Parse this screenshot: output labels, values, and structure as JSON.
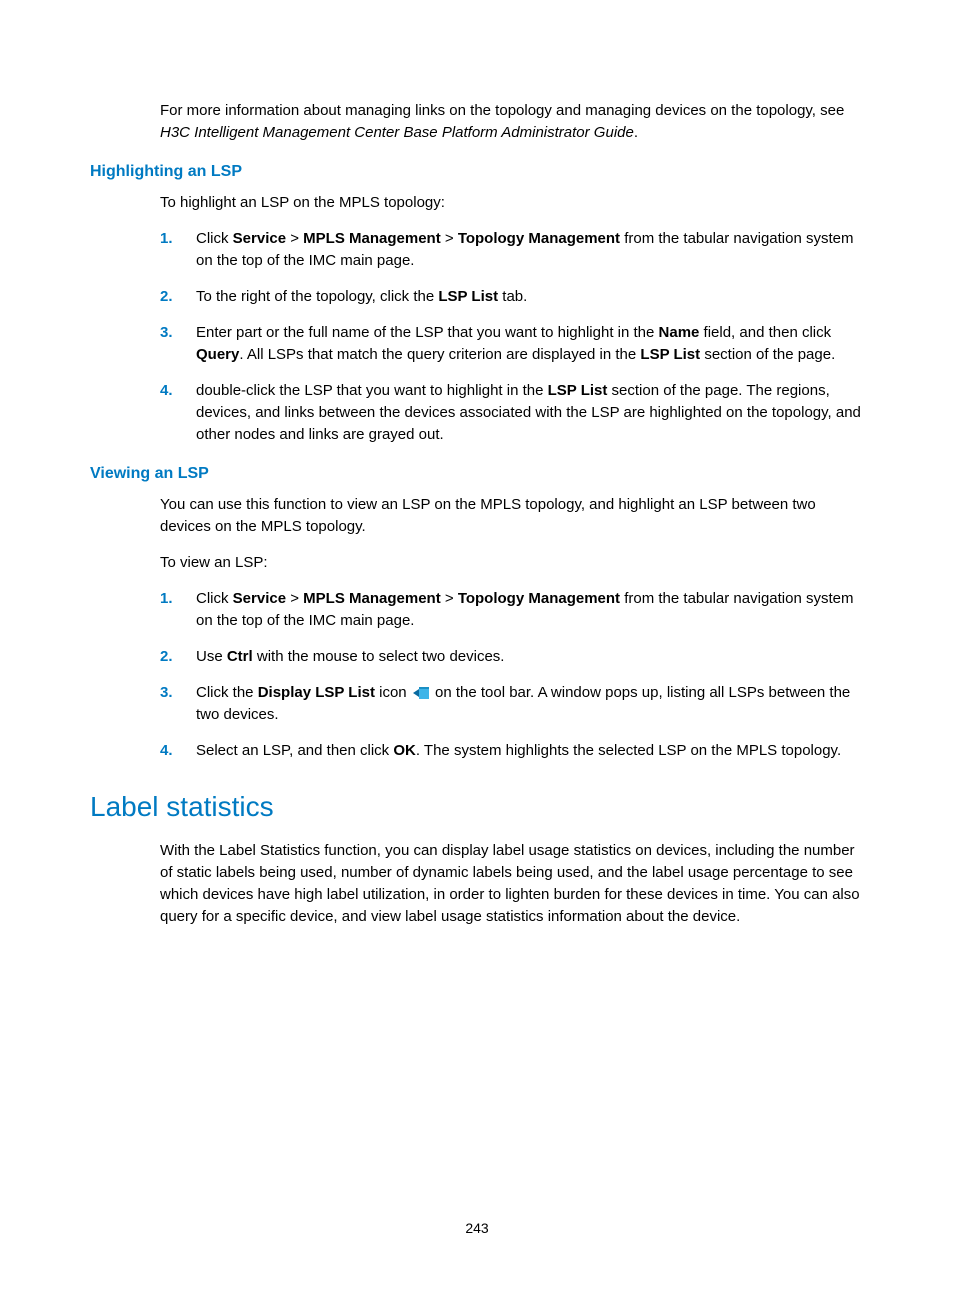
{
  "intro": {
    "p1a": "For more information about managing links on the topology and managing devices on the topology, see ",
    "p1b": "H3C Intelligent Management Center Base Platform Administrator Guide",
    "p1c": "."
  },
  "highlight": {
    "heading": "Highlighting an LSP",
    "p1": "To highlight an LSP on the MPLS topology:",
    "li1": {
      "num": "1.",
      "a": "Click ",
      "b1": "Service",
      "s1": " > ",
      "b2": "MPLS Management",
      "s2": " > ",
      "b3": "Topology Management",
      "c": " from the tabular navigation system on the top of the IMC main page."
    },
    "li2": {
      "num": "2.",
      "a": "To the right of the topology, click the ",
      "b1": "LSP List",
      "c": " tab."
    },
    "li3": {
      "num": "3.",
      "a": "Enter part or the full name of the LSP that you want to highlight in the ",
      "b1": "Name",
      "b": " field, and then click ",
      "b2": "Query",
      "c": ". All LSPs that match the query criterion are displayed in the ",
      "b3": "LSP List",
      "d": " section of the page."
    },
    "li4": {
      "num": "4.",
      "a": "double-click the LSP that you want to highlight in the ",
      "b1": "LSP List",
      "c": " section of the page. The regions, devices, and links between the devices associated with the LSP are highlighted on the topology, and other nodes and links are grayed out."
    }
  },
  "viewing": {
    "heading": "Viewing an LSP",
    "p1": "You can use this function to view an LSP on the MPLS topology, and highlight an LSP between two devices on the MPLS topology.",
    "p2": "To view an LSP:",
    "li1": {
      "num": "1.",
      "a": "Click ",
      "b1": "Service",
      "s1": " > ",
      "b2": "MPLS Management",
      "s2": " > ",
      "b3": "Topology Management",
      "c": " from the tabular navigation system on the top of the IMC main page."
    },
    "li2": {
      "num": "2.",
      "a": "Use ",
      "b1": "Ctrl",
      "c": " with the mouse to select two devices."
    },
    "li3": {
      "num": "3.",
      "a": "Click the ",
      "b1": "Display LSP List",
      "b": " icon ",
      "c": " on the tool bar. A window pops up, listing all LSPs between the two devices."
    },
    "li4": {
      "num": "4.",
      "a": "Select an LSP, and then click ",
      "b1": "OK",
      "c": ". The system highlights the selected LSP on the MPLS topology."
    }
  },
  "label_stats": {
    "heading": "Label statistics",
    "p1": "With the Label Statistics function, you can display label usage statistics on devices, including the number of static labels being used, number of dynamic labels being used, and the label usage percentage to see which devices have high label utilization, in order to lighten burden for these devices in time. You can also query for a specific device, and view label usage statistics information about the device."
  },
  "page_number": "243"
}
